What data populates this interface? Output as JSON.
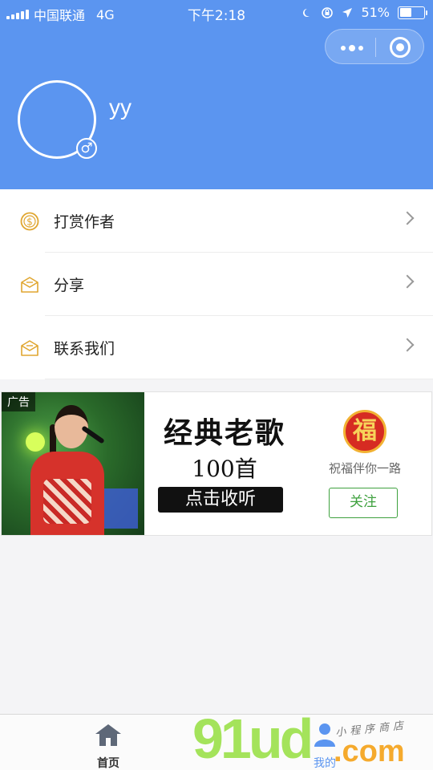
{
  "status_bar": {
    "carrier": "中国联通",
    "network": "4G",
    "time": "下午2:18",
    "battery": "51%",
    "battery_level": 0.51
  },
  "profile": {
    "username": "yy",
    "gender_symbol": "♂"
  },
  "menu": {
    "items": [
      {
        "label": "打赏作者",
        "icon": "coin-icon"
      },
      {
        "label": "分享",
        "icon": "envelope-icon"
      },
      {
        "label": "联系我们",
        "icon": "envelope-icon"
      }
    ]
  },
  "ad": {
    "tag": "广告",
    "title": "经典老歌",
    "subtitle": "100首",
    "cta": "点击收听",
    "logo_char": "福",
    "brand": "祝福伴你一路",
    "follow": "关注"
  },
  "tabbar": {
    "home": "首页",
    "mine": "我的"
  },
  "watermark": {
    "brand": "91ud",
    "suffix": ".com",
    "sub": "小程序商店"
  },
  "colors": {
    "header": "#5b95f0",
    "accent_gold": "#e0a630",
    "follow_green": "#3ea13e"
  }
}
